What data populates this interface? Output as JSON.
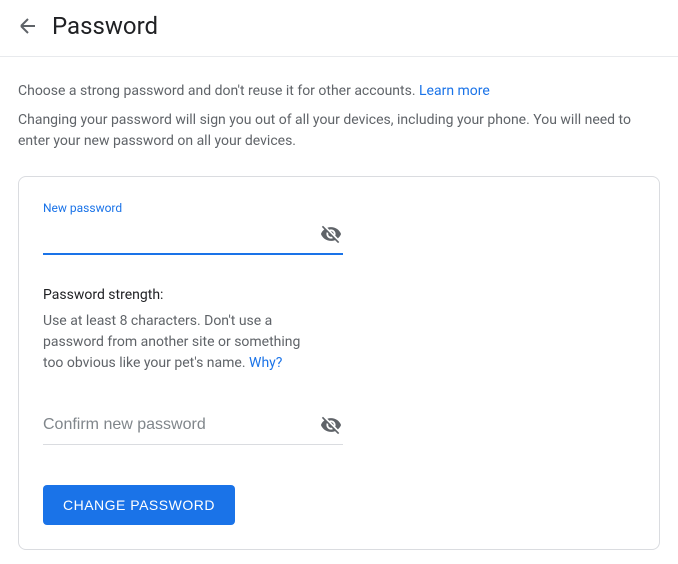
{
  "header": {
    "title": "Password"
  },
  "intro": {
    "line1": "Choose a strong password and don't reuse it for other accounts. ",
    "learn_more": "Learn more",
    "line2": "Changing your password will sign you out of all your devices, including your phone. You will need to enter your new password on all your devices."
  },
  "form": {
    "new_password_label": "New password",
    "new_password_value": "",
    "confirm_placeholder": "Confirm new password",
    "confirm_value": ""
  },
  "strength": {
    "title": "Password strength:",
    "text": "Use at least 8 characters. Don't use a password from another site or something too obvious like your pet's name. ",
    "why": "Why?"
  },
  "button": {
    "change": "Change Password"
  }
}
